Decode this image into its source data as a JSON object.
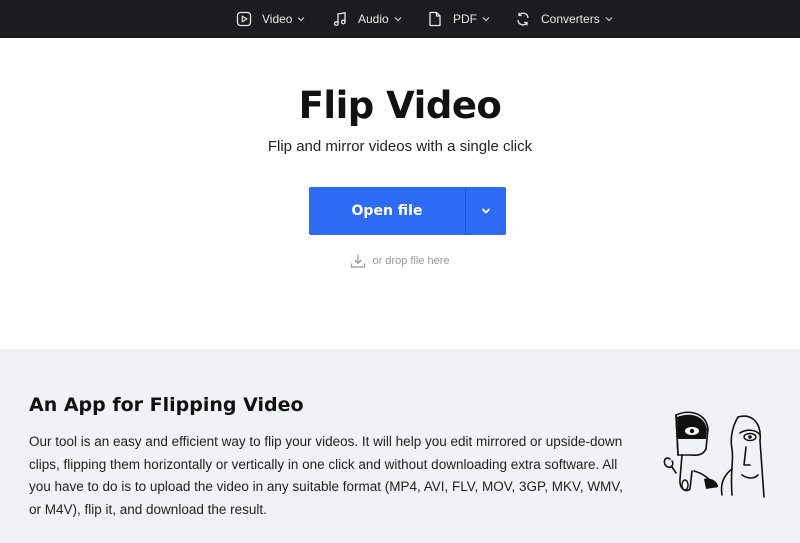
{
  "nav": {
    "items": [
      {
        "label": "Video",
        "icon": "video-icon"
      },
      {
        "label": "Audio",
        "icon": "music-note-icon"
      },
      {
        "label": "PDF",
        "icon": "document-icon"
      },
      {
        "label": "Converters",
        "icon": "converter-icon"
      }
    ]
  },
  "hero": {
    "title": "Flip Video",
    "subtitle": "Flip and mirror videos with a single click",
    "open_button": "Open file",
    "drop_text": "or drop file here"
  },
  "info": {
    "title": "An App for Flipping Video",
    "text": "Our tool is an easy and efficient way to flip your videos. It will help you edit mirrored or upside-down clips, flipping them horizontally or vertically in one click and without downloading extra software. All you have to do is to upload the video in any suitable format (MP4, AVI, FLV, MOV, 3GP, MKV, WMV, or M4V), flip it, and download the result."
  },
  "colors": {
    "nav_bg": "#1b1c1f",
    "accent": "#2e6bf5",
    "section_bg": "#f1f2f6"
  }
}
